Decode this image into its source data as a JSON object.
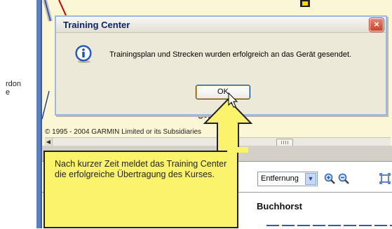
{
  "page_fragments": [
    "rdon",
    "e"
  ],
  "map": {
    "copyright": "© 1995 - 2004 GARMIN Limited or its Subsidiaries"
  },
  "toolbar": {
    "sort_select_value": "Entfernung"
  },
  "course_header": {
    "title": "Buchhorst"
  },
  "dialog": {
    "title": "Training Center",
    "message": "Trainingsplan und Strecken wurden erfolgreich an das Gerät gesendet.",
    "ok_label": "OK",
    "close_label": "×",
    "icon": "info-icon"
  },
  "callout": {
    "text": "Nach kurzer Zeit meldet das Training Center die erfolgreiche Übertragung des Kurses."
  },
  "colors": {
    "dialog_title_text": "#0a246a",
    "close_button": "#c8452a",
    "callout_background": "#fbf36b",
    "map_background": "#fbf6d6",
    "route_dash": "#ffd800",
    "window_frame": "#5c7fc0"
  }
}
